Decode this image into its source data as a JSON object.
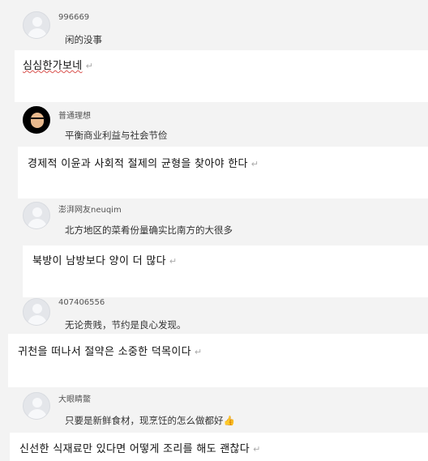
{
  "items": [
    {
      "username": "996669",
      "comment": "闲的没事",
      "korean": "심심한가보네",
      "mark": "↵",
      "avatar": "default"
    },
    {
      "username": "普通理想",
      "comment": "平衡商业利益与社会节俭",
      "korean": "경제적 이윤과 사회적 절제의 균형을 찾아야 한다",
      "mark": "↵",
      "avatar": "photo"
    },
    {
      "username": "澎湃网友neuqim",
      "comment": "北方地区的菜肴份量确实比南方的大很多",
      "korean": "북방이 남방보다 양이 더 많다",
      "mark": "↵",
      "avatar": "default"
    },
    {
      "username": "407406556",
      "comment": "无论贵贱，节约是良心发现。",
      "korean": "귀천을 떠나서 절약은 소중한 덕목이다",
      "mark": "↵",
      "avatar": "default"
    },
    {
      "username": "大眼睛鱉",
      "comment": "只要是新鲜食材，现烹饪的怎么做都好👍",
      "korean": "신선한 식재료만 있다면 어떻게 조리를 해도 괜찮다",
      "mark": "↵",
      "avatar": "default"
    }
  ]
}
